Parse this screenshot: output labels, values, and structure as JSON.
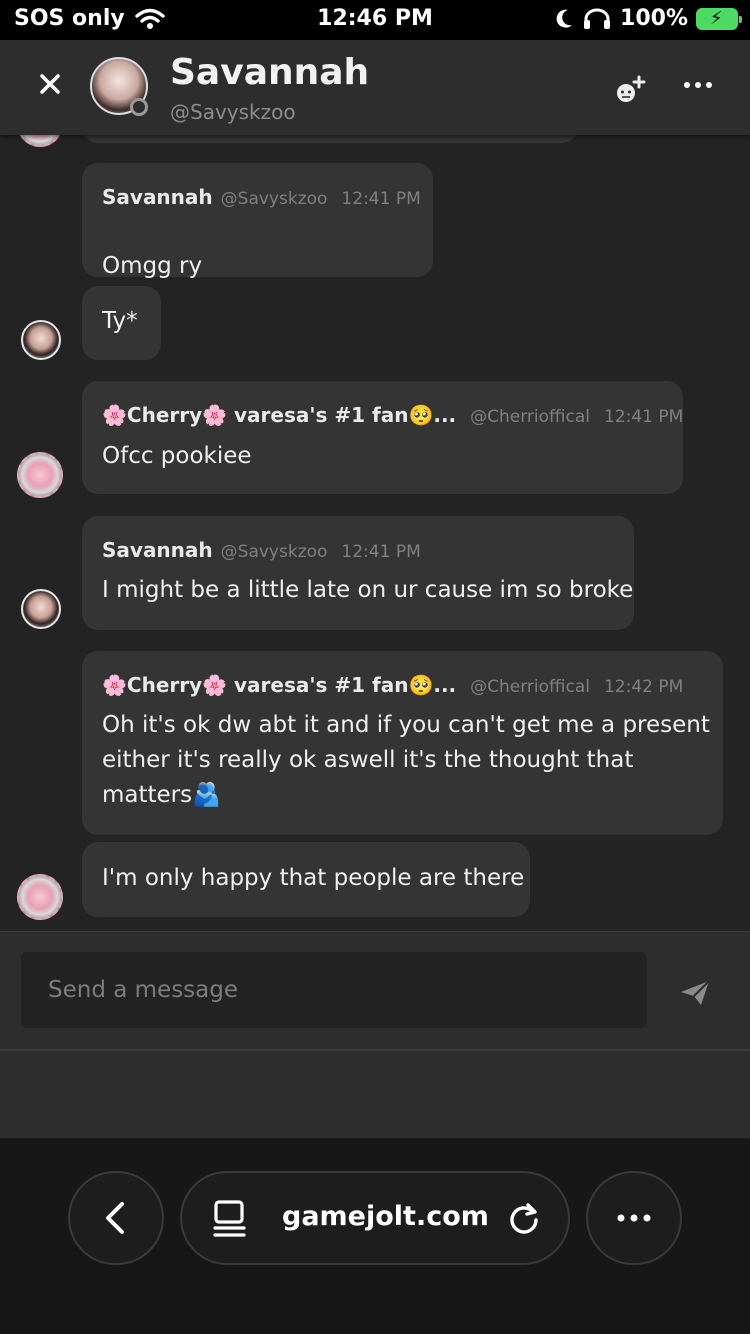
{
  "status_bar": {
    "carrier": "SOS only",
    "time": "12:46 PM",
    "battery": "100%"
  },
  "header": {
    "name": "Savannah",
    "handle": "@Savyskzoo"
  },
  "messages": [
    {
      "author": "Savannah",
      "handle": "@Savyskzoo",
      "time": "12:41 PM",
      "lines": [
        "Omgg ry"
      ]
    },
    {
      "lines": [
        "Ty*"
      ]
    },
    {
      "author_prefix": "🌸",
      "author": "Cherry",
      "author_suffix": "🌸 varesa's #1 fan🥺...",
      "handle": "@Cherrioffical",
      "time": "12:41 PM",
      "lines": [
        "Ofcc pookiee"
      ]
    },
    {
      "author": "Savannah",
      "handle": "@Savyskzoo",
      "time": "12:41 PM",
      "lines": [
        "I might be a little late on ur cause im so broke"
      ]
    },
    {
      "author_prefix": "🌸",
      "author": "Cherry",
      "author_suffix": "🌸 varesa's #1 fan🥺...",
      "handle": "@Cherrioffical",
      "time": "12:42 PM",
      "lines": [
        "Oh it's ok dw abt it and if you can't get me a present",
        "either it's really ok aswell it's the thought that",
        "matters🫂"
      ]
    },
    {
      "lines": [
        "I'm only happy that people are there"
      ]
    }
  ],
  "composer": {
    "placeholder": "Send a message"
  },
  "browser": {
    "url": "gamejolt.com"
  },
  "colors": {
    "background": "#232323",
    "bubble": "#343434",
    "header": "#2d2d2d",
    "battery": "#4cd964"
  },
  "icons": [
    "wifi-icon",
    "moon-icon",
    "headphones-icon",
    "battery-icon",
    "close-icon",
    "add-user-icon",
    "more-icon",
    "send-icon",
    "back-icon",
    "tab-icon",
    "reload-icon",
    "menu-icon"
  ]
}
